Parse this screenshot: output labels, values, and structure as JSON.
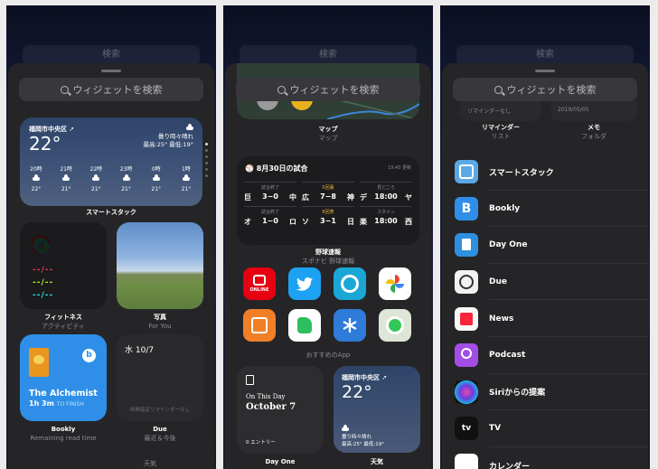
{
  "panel1": {
    "top_search": "検索",
    "search_placeholder": "ウィジェットを検索",
    "weather": {
      "city": "福岡市中央区 ➚",
      "temp": "22°",
      "condition": "曇り時々晴れ",
      "hilo": "最高:25° 最低:19°",
      "hours": [
        "20時",
        "21時",
        "22時",
        "23時",
        "0時",
        "1時"
      ],
      "temps": [
        "22°",
        "21°",
        "21°",
        "21°",
        "21°",
        "21°"
      ]
    },
    "smart_stack_caption": "スマートスタック",
    "fitness": {
      "move": "--/--",
      "exercise": "--/--",
      "stand": "--/--",
      "title": "フィットネス",
      "subtitle": "アクティビティ"
    },
    "photos": {
      "title": "写真",
      "subtitle": "For You"
    },
    "bookly": {
      "book": "The Alchemist",
      "time": "1h 3m",
      "to_finish": "TO FINISH",
      "title": "Bookly",
      "subtitle": "Remaining read time"
    },
    "due": {
      "date": "水 10/7",
      "note": "時間指定リマインダーなし",
      "title": "Due",
      "subtitle": "最近＆今後"
    },
    "bottom_label": "天気"
  },
  "panel2": {
    "top_search": "検索",
    "search_placeholder": "ウィジェットを検索",
    "maps": {
      "title": "マップ",
      "subtitle": "マップ"
    },
    "baseball": {
      "header": "8月30日の試合",
      "updated": "19:40 更新",
      "games": [
        {
          "status": "試合終了",
          "a": "巨",
          "score": "3−0",
          "b": "中",
          "yellow": false
        },
        {
          "status": "5回裏",
          "a": "広",
          "score": "7−8",
          "b": "神",
          "yellow": true
        },
        {
          "status": "見どころ",
          "a": "デ",
          "score": "18:00",
          "b": "ヤ",
          "yellow": false
        },
        {
          "status": "試合終了",
          "a": "オ",
          "score": "1−0",
          "b": "ロ",
          "yellow": false
        },
        {
          "status": "8回表",
          "a": "ソ",
          "score": "3−1",
          "b": "日",
          "yellow": true
        },
        {
          "status": "スタメン",
          "a": "楽",
          "score": "18:00",
          "b": "西",
          "yellow": false
        }
      ],
      "title": "野球速報",
      "subtitle": "スポナビ 野球速報"
    },
    "apps": [
      "ONLINE",
      "",
      "",
      "",
      "",
      "",
      "",
      ""
    ],
    "apps_caption": "おすすめのApp",
    "dayone": {
      "on_this_day": "On This Day",
      "date": "October 7",
      "entries": "0 エントリー",
      "title": "Day One"
    },
    "weather": {
      "city": "福岡市中央区 ➚",
      "temp": "22°",
      "condition": "曇り時々晴れ",
      "hilo": "最高:25° 最低:19°",
      "title": "天気"
    }
  },
  "panel3": {
    "top_search": "検索",
    "search_placeholder": "ウィジェットを検索",
    "reminders": {
      "card": "リマインダーなし",
      "title": "リマインダー",
      "subtitle": "リスト"
    },
    "memo": {
      "card": "2019/05/05",
      "title": "メモ",
      "subtitle": "フォルダ"
    },
    "list": [
      {
        "label": "スマートスタック",
        "icon": "smart-stack-icon",
        "color": "#5aa9e6"
      },
      {
        "label": "Bookly",
        "icon": "bookly-icon",
        "color": "#2f8fe8"
      },
      {
        "label": "Day One",
        "icon": "dayone-icon",
        "color": "#2e8fe0"
      },
      {
        "label": "Due",
        "icon": "due-icon",
        "color": "#f2f2f2"
      },
      {
        "label": "News",
        "icon": "news-icon",
        "color": "#f7f7f7"
      },
      {
        "label": "Podcast",
        "icon": "podcast-icon",
        "color": "#a24ee6"
      },
      {
        "label": "Siriからの提案",
        "icon": "siri-icon",
        "color": "#222"
      },
      {
        "label": "TV",
        "icon": "tv-icon",
        "color": "#111"
      },
      {
        "label": "カレンダー",
        "icon": "calendar-icon",
        "color": "#fff"
      }
    ]
  }
}
